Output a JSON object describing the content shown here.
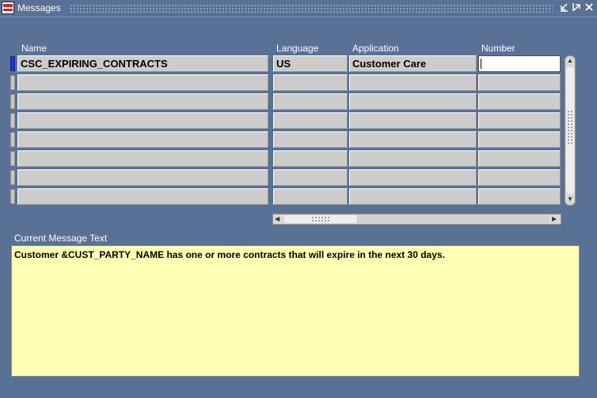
{
  "window": {
    "title": "Messages",
    "controls": [
      "minimize-icon",
      "maximize-icon",
      "close-icon"
    ]
  },
  "table": {
    "headers": {
      "name": "Name",
      "language": "Language",
      "application": "Application",
      "number": "Number"
    },
    "rows": [
      {
        "name": "CSC_EXPIRING_CONTRACTS",
        "language": "US",
        "application": "Customer Care",
        "number": ""
      },
      {
        "name": "",
        "language": "",
        "application": "",
        "number": ""
      },
      {
        "name": "",
        "language": "",
        "application": "",
        "number": ""
      },
      {
        "name": "",
        "language": "",
        "application": "",
        "number": ""
      },
      {
        "name": "",
        "language": "",
        "application": "",
        "number": ""
      },
      {
        "name": "",
        "language": "",
        "application": "",
        "number": ""
      },
      {
        "name": "",
        "language": "",
        "application": "",
        "number": ""
      },
      {
        "name": "",
        "language": "",
        "application": "",
        "number": ""
      }
    ]
  },
  "message": {
    "label": "Current Message Text",
    "text": "Customer &CUST_PARTY_NAME has one or more contracts that will expire in the next 30 days."
  },
  "colors": {
    "background": "#5a7196",
    "field": "#cccccc",
    "message_field": "#ffffb4",
    "current_record": "#2434c8"
  }
}
